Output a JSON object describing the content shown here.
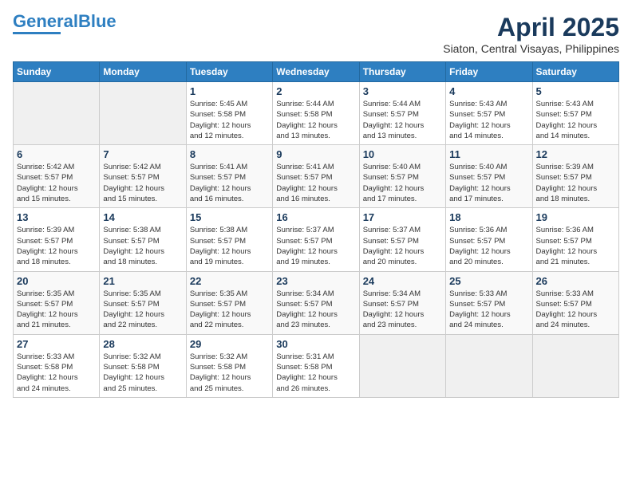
{
  "header": {
    "logo_line1": "General",
    "logo_line2": "Blue",
    "month_year": "April 2025",
    "location": "Siaton, Central Visayas, Philippines"
  },
  "days_of_week": [
    "Sunday",
    "Monday",
    "Tuesday",
    "Wednesday",
    "Thursday",
    "Friday",
    "Saturday"
  ],
  "weeks": [
    [
      {
        "day": "",
        "info": ""
      },
      {
        "day": "",
        "info": ""
      },
      {
        "day": "1",
        "info": "Sunrise: 5:45 AM\nSunset: 5:58 PM\nDaylight: 12 hours\nand 12 minutes."
      },
      {
        "day": "2",
        "info": "Sunrise: 5:44 AM\nSunset: 5:58 PM\nDaylight: 12 hours\nand 13 minutes."
      },
      {
        "day": "3",
        "info": "Sunrise: 5:44 AM\nSunset: 5:57 PM\nDaylight: 12 hours\nand 13 minutes."
      },
      {
        "day": "4",
        "info": "Sunrise: 5:43 AM\nSunset: 5:57 PM\nDaylight: 12 hours\nand 14 minutes."
      },
      {
        "day": "5",
        "info": "Sunrise: 5:43 AM\nSunset: 5:57 PM\nDaylight: 12 hours\nand 14 minutes."
      }
    ],
    [
      {
        "day": "6",
        "info": "Sunrise: 5:42 AM\nSunset: 5:57 PM\nDaylight: 12 hours\nand 15 minutes."
      },
      {
        "day": "7",
        "info": "Sunrise: 5:42 AM\nSunset: 5:57 PM\nDaylight: 12 hours\nand 15 minutes."
      },
      {
        "day": "8",
        "info": "Sunrise: 5:41 AM\nSunset: 5:57 PM\nDaylight: 12 hours\nand 16 minutes."
      },
      {
        "day": "9",
        "info": "Sunrise: 5:41 AM\nSunset: 5:57 PM\nDaylight: 12 hours\nand 16 minutes."
      },
      {
        "day": "10",
        "info": "Sunrise: 5:40 AM\nSunset: 5:57 PM\nDaylight: 12 hours\nand 17 minutes."
      },
      {
        "day": "11",
        "info": "Sunrise: 5:40 AM\nSunset: 5:57 PM\nDaylight: 12 hours\nand 17 minutes."
      },
      {
        "day": "12",
        "info": "Sunrise: 5:39 AM\nSunset: 5:57 PM\nDaylight: 12 hours\nand 18 minutes."
      }
    ],
    [
      {
        "day": "13",
        "info": "Sunrise: 5:39 AM\nSunset: 5:57 PM\nDaylight: 12 hours\nand 18 minutes."
      },
      {
        "day": "14",
        "info": "Sunrise: 5:38 AM\nSunset: 5:57 PM\nDaylight: 12 hours\nand 18 minutes."
      },
      {
        "day": "15",
        "info": "Sunrise: 5:38 AM\nSunset: 5:57 PM\nDaylight: 12 hours\nand 19 minutes."
      },
      {
        "day": "16",
        "info": "Sunrise: 5:37 AM\nSunset: 5:57 PM\nDaylight: 12 hours\nand 19 minutes."
      },
      {
        "day": "17",
        "info": "Sunrise: 5:37 AM\nSunset: 5:57 PM\nDaylight: 12 hours\nand 20 minutes."
      },
      {
        "day": "18",
        "info": "Sunrise: 5:36 AM\nSunset: 5:57 PM\nDaylight: 12 hours\nand 20 minutes."
      },
      {
        "day": "19",
        "info": "Sunrise: 5:36 AM\nSunset: 5:57 PM\nDaylight: 12 hours\nand 21 minutes."
      }
    ],
    [
      {
        "day": "20",
        "info": "Sunrise: 5:35 AM\nSunset: 5:57 PM\nDaylight: 12 hours\nand 21 minutes."
      },
      {
        "day": "21",
        "info": "Sunrise: 5:35 AM\nSunset: 5:57 PM\nDaylight: 12 hours\nand 22 minutes."
      },
      {
        "day": "22",
        "info": "Sunrise: 5:35 AM\nSunset: 5:57 PM\nDaylight: 12 hours\nand 22 minutes."
      },
      {
        "day": "23",
        "info": "Sunrise: 5:34 AM\nSunset: 5:57 PM\nDaylight: 12 hours\nand 23 minutes."
      },
      {
        "day": "24",
        "info": "Sunrise: 5:34 AM\nSunset: 5:57 PM\nDaylight: 12 hours\nand 23 minutes."
      },
      {
        "day": "25",
        "info": "Sunrise: 5:33 AM\nSunset: 5:57 PM\nDaylight: 12 hours\nand 24 minutes."
      },
      {
        "day": "26",
        "info": "Sunrise: 5:33 AM\nSunset: 5:57 PM\nDaylight: 12 hours\nand 24 minutes."
      }
    ],
    [
      {
        "day": "27",
        "info": "Sunrise: 5:33 AM\nSunset: 5:58 PM\nDaylight: 12 hours\nand 24 minutes."
      },
      {
        "day": "28",
        "info": "Sunrise: 5:32 AM\nSunset: 5:58 PM\nDaylight: 12 hours\nand 25 minutes."
      },
      {
        "day": "29",
        "info": "Sunrise: 5:32 AM\nSunset: 5:58 PM\nDaylight: 12 hours\nand 25 minutes."
      },
      {
        "day": "30",
        "info": "Sunrise: 5:31 AM\nSunset: 5:58 PM\nDaylight: 12 hours\nand 26 minutes."
      },
      {
        "day": "",
        "info": ""
      },
      {
        "day": "",
        "info": ""
      },
      {
        "day": "",
        "info": ""
      }
    ]
  ]
}
